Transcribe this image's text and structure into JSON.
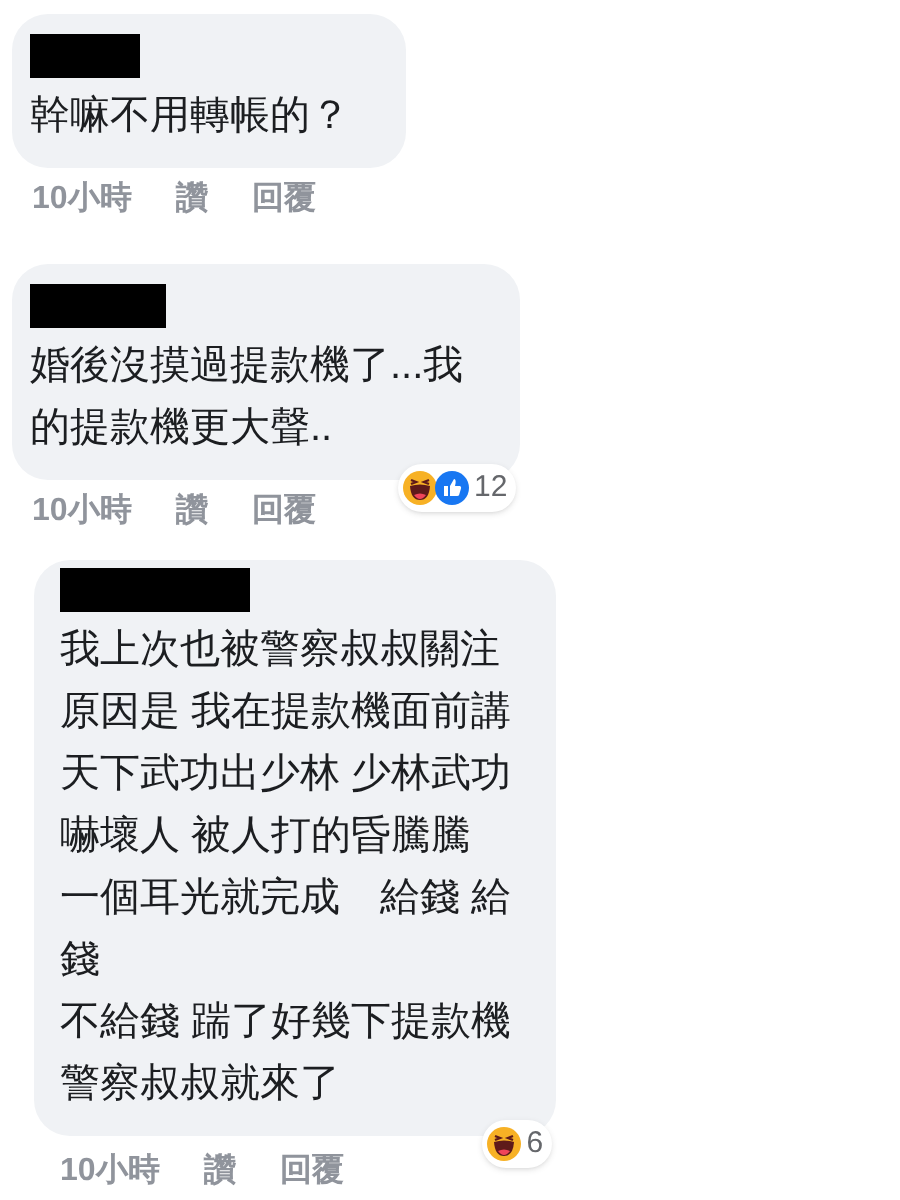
{
  "comments": [
    {
      "lines": [
        "幹嘛不用轉帳的？"
      ],
      "time": "10小時",
      "like": "讚",
      "reply": "回覆",
      "indent": false
    },
    {
      "lines": [
        "婚後沒摸過提款機了...我",
        "的提款機更大聲.."
      ],
      "time": "10小時",
      "like": "讚",
      "reply": "回覆",
      "reactions": [
        {
          "kind": "haha"
        },
        {
          "kind": "like"
        }
      ],
      "reaction_count": "12",
      "indent": false
    },
    {
      "lines": [
        "我上次也被警察叔叔關注",
        "原因是 我在提款機面前講",
        "天下武功出少林 少林武功",
        "嚇壞人 被人打的昏騰騰",
        "一個耳光就完成　給錢 給",
        "錢",
        "不給錢 踹了好幾下提款機",
        "警察叔叔就來了"
      ],
      "time": "10小時",
      "like": "讚",
      "reply": "回覆",
      "reactions": [
        {
          "kind": "haha"
        }
      ],
      "reaction_count": "6",
      "indent": true
    }
  ]
}
